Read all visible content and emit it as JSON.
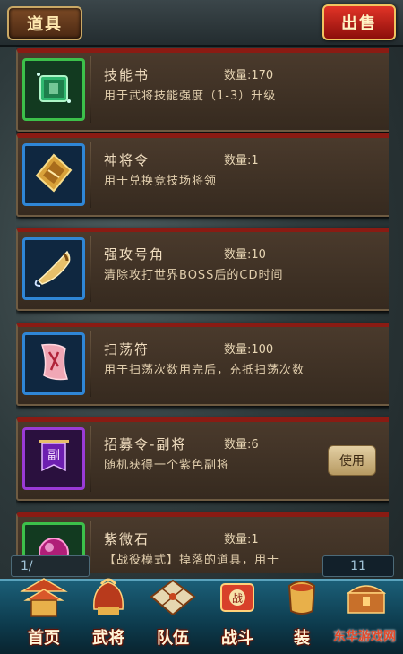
{
  "header": {
    "items_label": "道具",
    "sell_label": "出售"
  },
  "items": [
    {
      "name": "技能书",
      "qty": "数量:170",
      "desc": "用于武将技能强度（1-3）升级",
      "icon": "skill-book-icon",
      "frame_color": "#3cc04a"
    },
    {
      "name": "神将令",
      "qty": "数量:1",
      "desc": "用于兑换竞技场将领",
      "icon": "general-token-icon",
      "frame_color": "#2f86d6"
    },
    {
      "name": "强攻号角",
      "qty": "数量:10",
      "desc": "清除攻打世界BOSS后的CD时间",
      "icon": "war-horn-icon",
      "frame_color": "#2f86d6"
    },
    {
      "name": "扫荡符",
      "qty": "数量:100",
      "desc": "用于扫荡次数用完后，充抵扫荡次数",
      "icon": "sweep-talisman-icon",
      "frame_color": "#2f86d6"
    },
    {
      "name": "招募令-副将",
      "qty": "数量:6",
      "desc": "随机获得一个紫色副将",
      "icon": "recruit-banner-icon",
      "frame_color": "#9a3ad6",
      "action": "使用"
    },
    {
      "name": "紫微石",
      "qty": "数量:1",
      "desc": "【战役模式】掉落的道具，用于",
      "icon": "purple-stone-icon",
      "frame_color": "#3cc04a"
    }
  ],
  "pager": {
    "left": "1/",
    "right": "11"
  },
  "nav": [
    {
      "label": "首页",
      "icon": "home-pagoda-icon"
    },
    {
      "label": "武将",
      "icon": "general-helmet-icon"
    },
    {
      "label": "队伍",
      "icon": "team-board-icon"
    },
    {
      "label": "战斗",
      "icon": "battle-scroll-icon"
    },
    {
      "label": "装",
      "icon": "equipment-icon"
    },
    {
      "label": "",
      "icon": "treasure-chest-icon"
    }
  ],
  "watermark": "东华游戏网",
  "colors": {
    "accent_red": "#8a1b13",
    "panel_brown": "#3f3124",
    "nav_teal": "#0d3b4d"
  }
}
